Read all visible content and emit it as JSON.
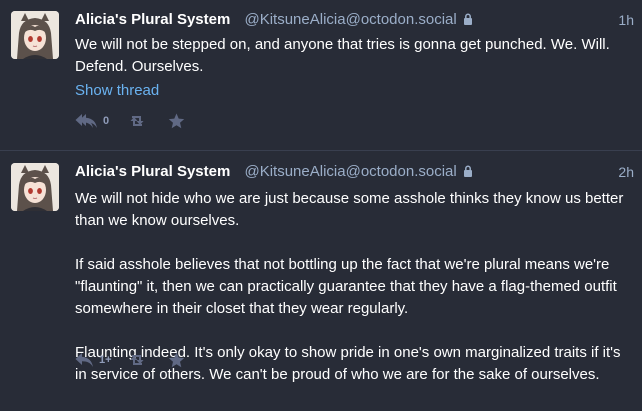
{
  "statuses": [
    {
      "display_name": "Alicia's Plural System",
      "acct": "@KitsuneAlicia@octodon.social",
      "time": "1h",
      "paragraphs": [
        "We will not be stepped on, and anyone that tries is gonna get punched. We. Will. Defend. Ourselves."
      ],
      "show_thread": "Show thread",
      "reply_icon": "reply-all-icon",
      "reply_count": "0"
    },
    {
      "display_name": "Alicia's Plural System",
      "acct": "@KitsuneAlicia@octodon.social",
      "time": "2h",
      "paragraphs": [
        "We will not hide who we are just because some asshole thinks they know us better than we know ourselves.",
        "If said asshole believes that not bottling up the fact that we're plural means we're \"flaunting\" it, then we can practically guarantee that they have a flag-themed outfit somewhere in their closet that they wear regularly.",
        "Flaunting indeed. It's only okay to show pride in one's own marginalized traits if it's in service of others. We can't be proud of who we are for the sake of ourselves."
      ],
      "reply_icon": "reply-icon",
      "reply_count": "1+"
    }
  ],
  "colors": {
    "background": "#282c37",
    "secondary_text": "#9baec8",
    "link": "#6ab2f0",
    "action_icon": "#606984"
  }
}
